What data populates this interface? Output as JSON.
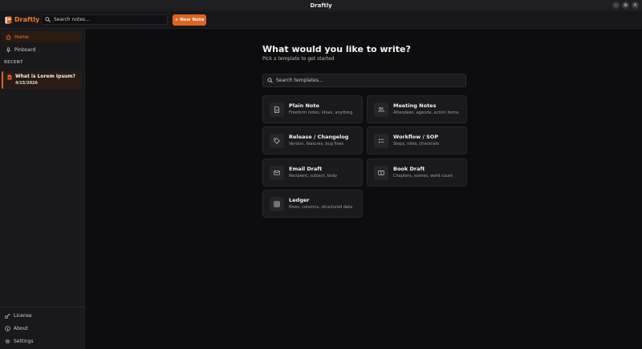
{
  "window": {
    "title": "Draftly",
    "controls": [
      "–",
      "⊕",
      "✕"
    ]
  },
  "toolbar": {
    "brand": "Draftly",
    "search_placeholder": "Search notes...",
    "new_note_label": "+ New Note"
  },
  "colors": {
    "accent": "#e0641e",
    "brand": "#f07a2a",
    "background": "#0d0d0f",
    "sidebar": "#19191b"
  },
  "sidebar": {
    "nav": [
      {
        "label": "Home",
        "icon": "home-icon",
        "active": true
      },
      {
        "label": "Pinboard",
        "icon": "pin-icon",
        "active": false
      }
    ],
    "recent_label": "RECENT",
    "recent": [
      {
        "title": "What is Lorem Ipsum?",
        "date": "4/15/2026",
        "icon": "document-icon"
      }
    ],
    "bottom": [
      {
        "label": "License",
        "icon": "key-icon"
      },
      {
        "label": "About",
        "icon": "info-icon"
      },
      {
        "label": "Settings",
        "icon": "gear-icon"
      }
    ]
  },
  "main": {
    "heading": "What would you like to write?",
    "subheading": "Pick a template to get started",
    "search_placeholder": "Search templates...",
    "templates": [
      {
        "name": "Plain Note",
        "desc": "Freeform notes, ideas, anything",
        "icon": "document-icon"
      },
      {
        "name": "Meeting Notes",
        "desc": "Attendees, agenda, action items",
        "icon": "people-icon"
      },
      {
        "name": "Release / Changelog",
        "desc": "Version, features, bug fixes",
        "icon": "tag-icon"
      },
      {
        "name": "Workflow / SOP",
        "desc": "Steps, roles, checklists",
        "icon": "checklist-icon"
      },
      {
        "name": "Email Draft",
        "desc": "Recipient, subject, body",
        "icon": "mail-icon"
      },
      {
        "name": "Book Draft",
        "desc": "Chapters, scenes, word count",
        "icon": "book-icon"
      },
      {
        "name": "Ledger",
        "desc": "Rows, columns, structured data",
        "icon": "grid-icon"
      }
    ]
  }
}
